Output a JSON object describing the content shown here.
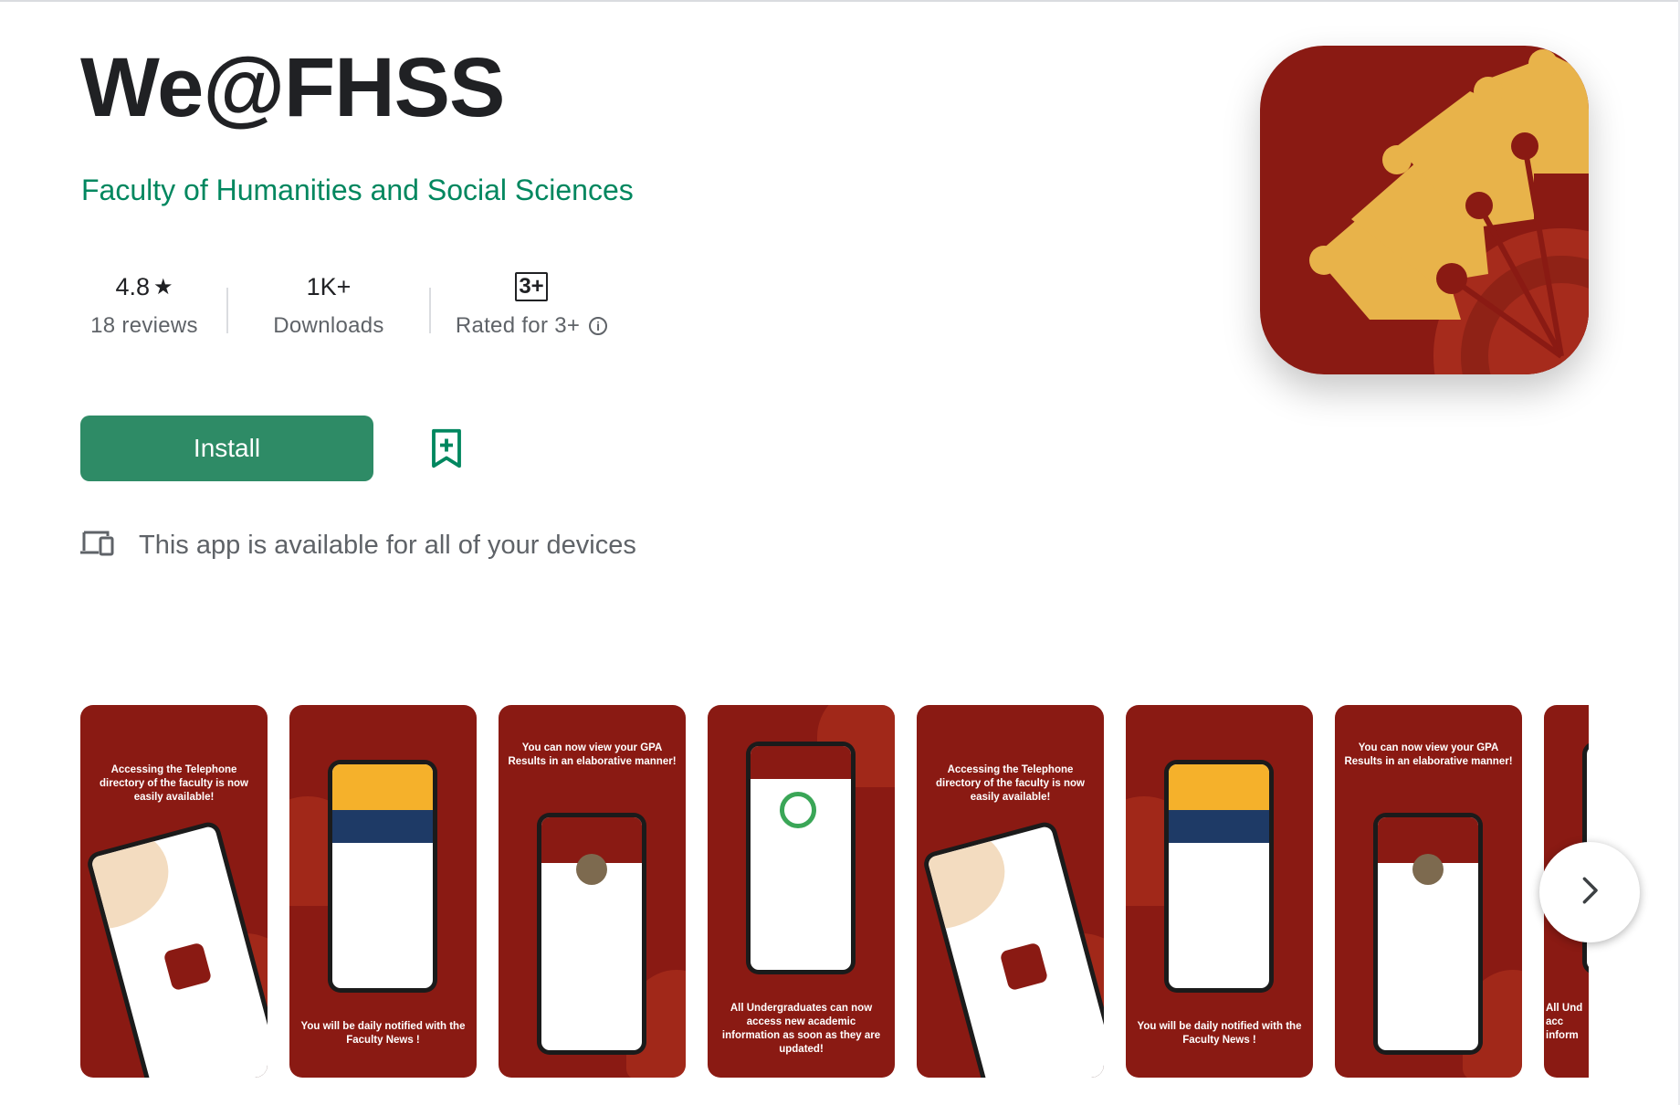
{
  "app": {
    "title": "We@FHSS",
    "developer": "Faculty of Humanities and Social Sciences"
  },
  "stats": {
    "rating_value": "4.8",
    "rating_star": "★",
    "reviews_label": "18 reviews",
    "downloads_value": "1K+",
    "downloads_label": "Downloads",
    "content_rating_badge": "3+",
    "content_rating_label": "Rated for 3+"
  },
  "actions": {
    "install_label": "Install",
    "wishlist_icon": "bookmark-add-icon"
  },
  "devices": {
    "icon": "devices-icon",
    "text": "This app is available for all of your devices"
  },
  "screenshots": [
    {
      "caption_top": "Accessing the Telephone directory of the faculty is now easily available!",
      "caption_bottom": ""
    },
    {
      "caption_top": "",
      "caption_bottom": "You will be daily notified with the Faculty News !"
    },
    {
      "caption_top": "You can now view your GPA Results in an elaborative manner!",
      "caption_bottom": ""
    },
    {
      "caption_top": "",
      "caption_bottom": "All Undergraduates can now access new academic information as soon as they are updated!"
    },
    {
      "caption_top": "Accessing the Telephone directory of the faculty is now easily available!",
      "caption_bottom": ""
    },
    {
      "caption_top": "",
      "caption_bottom": "You will be daily notified with the Faculty News !"
    },
    {
      "caption_top": "You can now view your GPA Results in an elaborative manner!",
      "caption_bottom": ""
    },
    {
      "caption_top": "",
      "caption_bottom": "All Und acc inform"
    }
  ],
  "colors": {
    "accent_green": "#01875f",
    "install_green": "#2e8b66",
    "icon_red": "#8a1a13",
    "icon_gold": "#e8b34a"
  },
  "carousel": {
    "next_icon": "chevron-right-icon"
  }
}
